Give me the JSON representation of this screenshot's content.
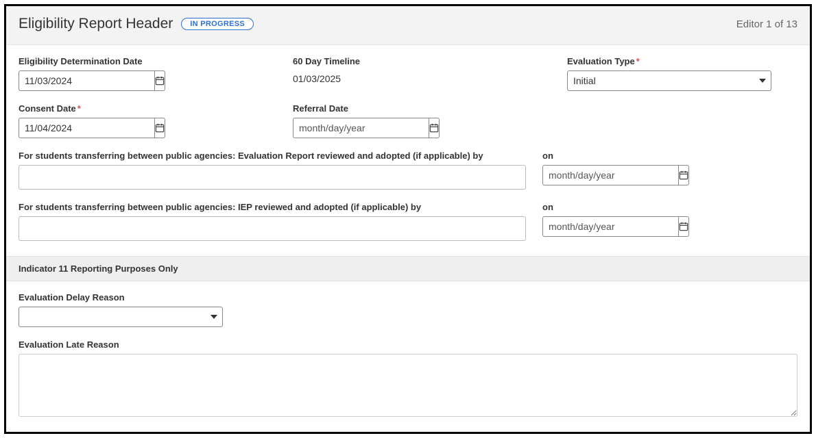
{
  "header": {
    "title": "Eligibility Report Header",
    "status": "IN PROGRESS",
    "editor": "Editor 1 of 13"
  },
  "fields": {
    "eligibility_date": {
      "label": "Eligibility Determination Date",
      "value": "11/03/2024"
    },
    "timeline": {
      "label": "60 Day Timeline",
      "value": "01/03/2025"
    },
    "eval_type": {
      "label": "Evaluation Type",
      "value": "Initial"
    },
    "consent_date": {
      "label": "Consent Date",
      "value": "11/04/2024"
    },
    "referral_date": {
      "label": "Referral Date",
      "placeholder": "month/day/year",
      "value": ""
    },
    "transfer_eval": {
      "label": "For students transferring between public agencies: Evaluation Report reviewed and adopted (if applicable) by",
      "value": "",
      "on_label": "on",
      "on_placeholder": "month/day/year",
      "on_value": ""
    },
    "transfer_iep": {
      "label": "For students transferring between public agencies: IEP reviewed and adopted (if applicable) by",
      "value": "",
      "on_label": "on",
      "on_placeholder": "month/day/year",
      "on_value": ""
    }
  },
  "section": {
    "title": "Indicator 11 Reporting Purposes Only"
  },
  "delay_reason": {
    "label": "Evaluation Delay Reason",
    "value": ""
  },
  "late_reason": {
    "label": "Evaluation Late Reason",
    "value": ""
  }
}
